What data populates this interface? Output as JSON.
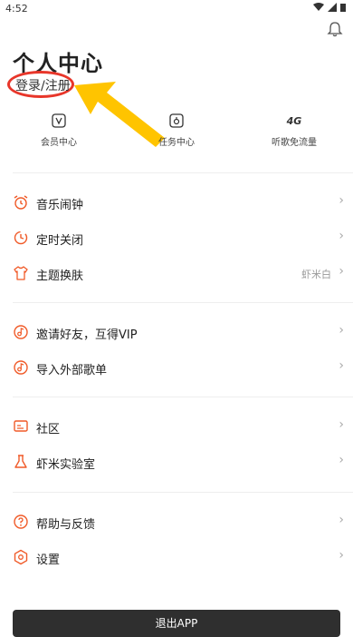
{
  "status_bar": {
    "time": "4:52"
  },
  "header": {
    "title": "个人中心",
    "login_link": "登录/注册"
  },
  "quick_actions": [
    {
      "label": "会员中心",
      "icon": "vip-icon"
    },
    {
      "label": "任务中心",
      "icon": "task-icon"
    },
    {
      "label": "听歌免流量",
      "icon": "4g-icon",
      "icon_text": "4G"
    }
  ],
  "menu_groups": [
    [
      {
        "label": "音乐闹钟",
        "icon": "alarm-clock-icon"
      },
      {
        "label": "定时关闭",
        "icon": "timer-icon"
      },
      {
        "label": "主题换肤",
        "icon": "shirt-icon",
        "value": "虾米白"
      }
    ],
    [
      {
        "label": "邀请好友，互得VIP",
        "icon": "invite-icon"
      },
      {
        "label": "导入外部歌单",
        "icon": "import-icon"
      }
    ],
    [
      {
        "label": "社区",
        "icon": "community-icon"
      },
      {
        "label": "虾米实验室",
        "icon": "lab-flask-icon"
      }
    ],
    [
      {
        "label": "帮助与反馈",
        "icon": "help-icon"
      },
      {
        "label": "设置",
        "icon": "settings-icon"
      }
    ]
  ],
  "logout_button": "退出APP",
  "colors": {
    "accent": "#f05a28",
    "annotation_red": "#e8362a",
    "annotation_arrow": "#ffc400"
  }
}
